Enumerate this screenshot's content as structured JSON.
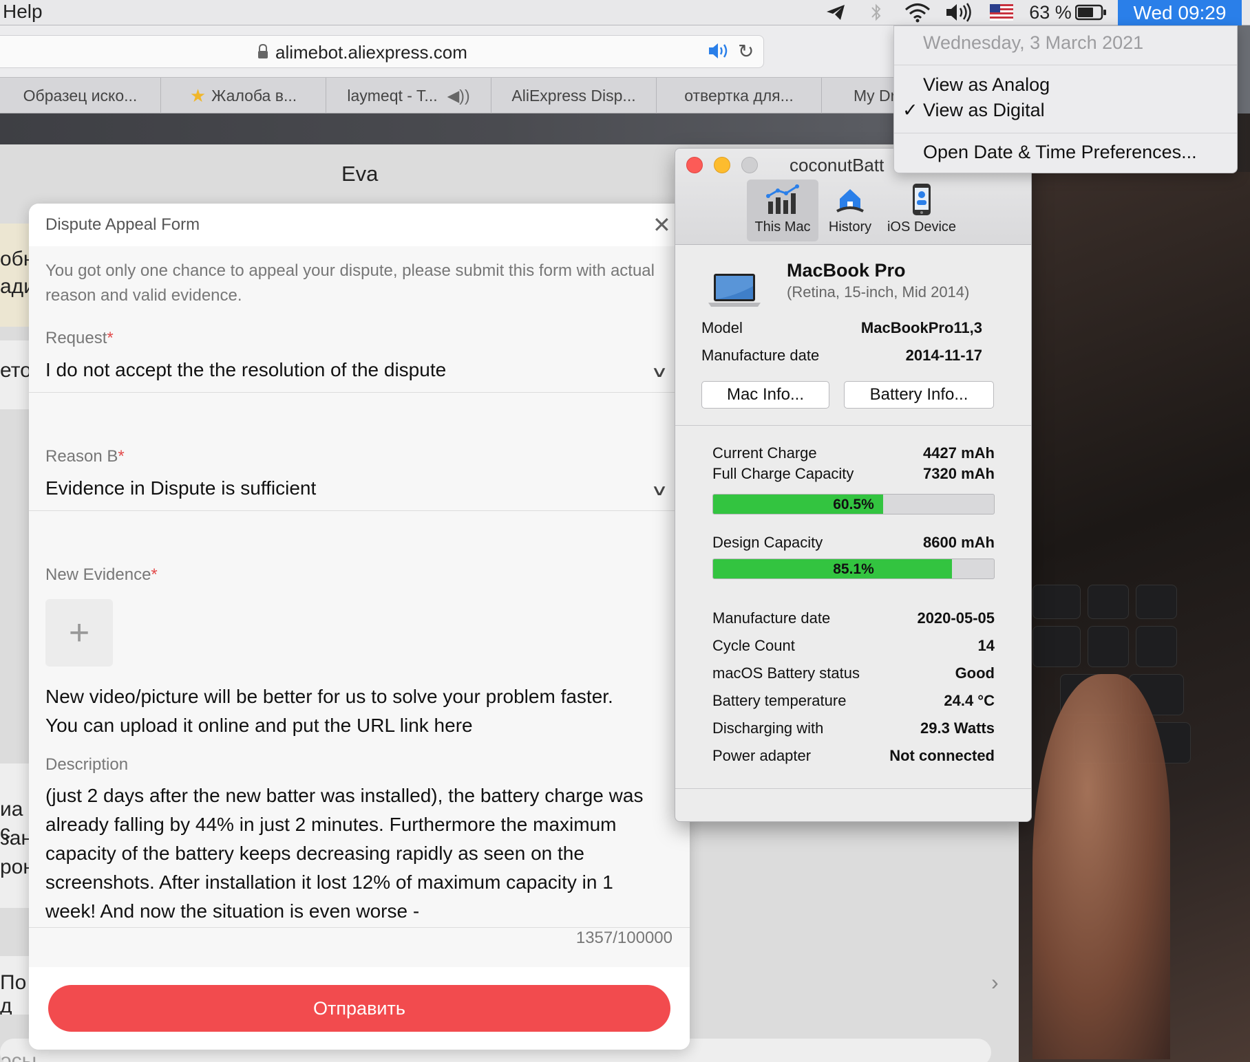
{
  "menubar": {
    "help": "Help",
    "battery_percent": "63 %",
    "clock": "Wed 09:29"
  },
  "clock_menu": {
    "date": "Wednesday, 3 March 2021",
    "view_analog": "View as Analog",
    "view_digital": "View as Digital",
    "check": "✓",
    "open_prefs": "Open Date & Time Preferences..."
  },
  "browser": {
    "url": "alimebot.aliexpress.com",
    "tabs": [
      {
        "label": "Образец иско..."
      },
      {
        "label": "Жалоба в..."
      },
      {
        "label": "laymeqt - T..."
      },
      {
        "label": "AliExpress Disp..."
      },
      {
        "label": "отвертка для..."
      },
      {
        "label": "My Dr"
      }
    ]
  },
  "chat": {
    "title": "Eva",
    "bg_fragments": [
      "обн",
      "ади",
      "ето",
      "иа с",
      "зан",
      "рон",
      "По д",
      "осы"
    ]
  },
  "dialog": {
    "title": "Dispute Appeal Form",
    "intro": "You got only one chance to appeal your dispute, please submit this form with actual reason and valid evidence.",
    "request_label": "Request",
    "request_value": "I do not accept the the resolution of the dispute",
    "reason_label": "Reason B",
    "reason_value": "Evidence in Dispute is sufficient",
    "evidence_label": "New Evidence",
    "required_mark": "*",
    "upload_plus": "+",
    "evidence_hint_1": "New video/picture will be better for us to solve your problem faster.",
    "evidence_hint_2": "You can upload it online and put the URL link here",
    "description_label": "Description",
    "description": [
      "(just 2 days after the new batter was installed), the battery charge was",
      "already falling by 44% in just 2 minutes. Furthermore the maximum",
      "capacity of the battery keeps decreasing rapidly as seen on the",
      "screenshots. After installation it lost 12% of maximum capacity in 1",
      "week! And now the situation is even worse -"
    ],
    "counter": "1357/100000",
    "submit": "Отправить"
  },
  "coconut": {
    "window_title": "coconutBatt",
    "toolbar": {
      "this_mac": "This Mac",
      "history": "History",
      "ios_device": "iOS Device"
    },
    "mac_name": "MacBook Pro",
    "mac_sub": "(Retina, 15-inch, Mid 2014)",
    "model_label": "Model",
    "model_value": "MacBookPro11,3",
    "mfg_label": "Manufacture date",
    "mfg_value": "2014-11-17",
    "mac_info_btn": "Mac Info...",
    "battery_info_btn": "Battery Info...",
    "current_charge_label": "Current Charge",
    "current_charge_value": "4427 mAh",
    "full_capacity_label": "Full Charge Capacity",
    "full_capacity_value": "7320 mAh",
    "charge_pct_text": "60.5%",
    "charge_pct": 60.5,
    "design_capacity_label": "Design Capacity",
    "design_capacity_value": "8600 mAh",
    "design_pct_text": "85.1%",
    "design_pct": 85.1,
    "bat_mfg_label": "Manufacture date",
    "bat_mfg_value": "2020-05-05",
    "cycle_label": "Cycle Count",
    "cycle_value": "14",
    "status_label": "macOS Battery status",
    "status_value": "Good",
    "temp_label": "Battery temperature",
    "temp_value": "24.4 °C",
    "discharge_label": "Discharging with",
    "discharge_value": "29.3 Watts",
    "adapter_label": "Power adapter",
    "adapter_value": "Not connected"
  },
  "colors": {
    "accent_blue": "#2a7fe9",
    "submit_red": "#f24b4e",
    "bar_green": "#33c440"
  }
}
